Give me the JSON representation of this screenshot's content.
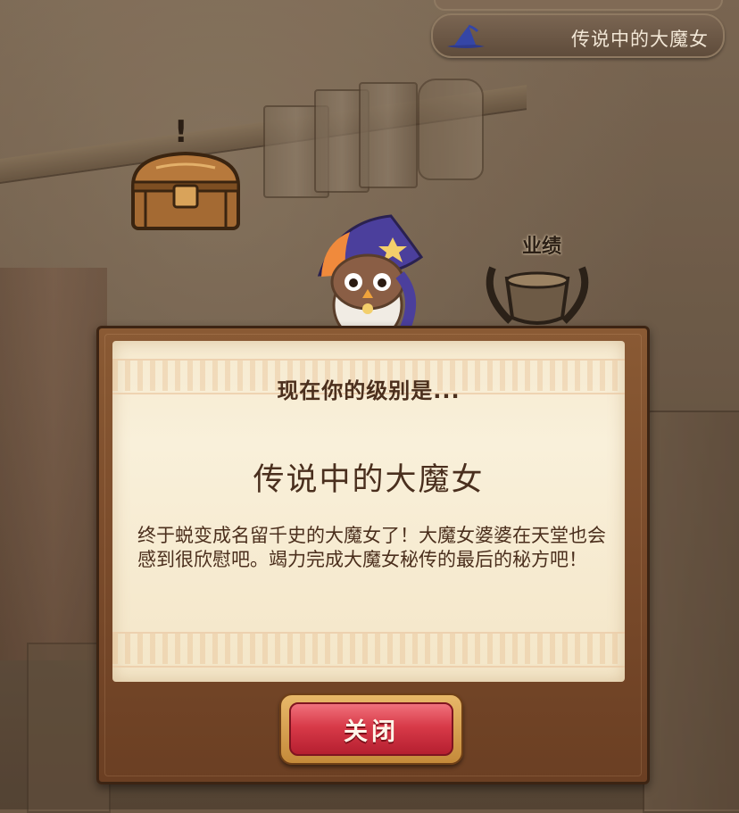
{
  "header": {
    "rank_badge_text": "传说中的大魔女",
    "rank_badge_icon": "witch-hat-icon"
  },
  "scene": {
    "chest_icon": "treasure-chest-icon",
    "chest_alert": "!",
    "achievements_label": "业绩",
    "achievements_icon": "trophy-icon",
    "mascot_icon": "owl-witch-icon"
  },
  "dialog": {
    "heading": "现在你的级别是...",
    "rank_name": "传说中的大魔女",
    "description": "终于蜕变成名留千史的大魔女了！大魔女婆婆在天堂也会感到很欣慰吧。竭力完成大魔女秘传的最后的秘方吧！",
    "close_label": "关闭"
  },
  "colors": {
    "frame": "#7a4b2b",
    "parchment": "#f6ead0",
    "button_red": "#d83a48",
    "text_brown": "#4b2f1d"
  }
}
